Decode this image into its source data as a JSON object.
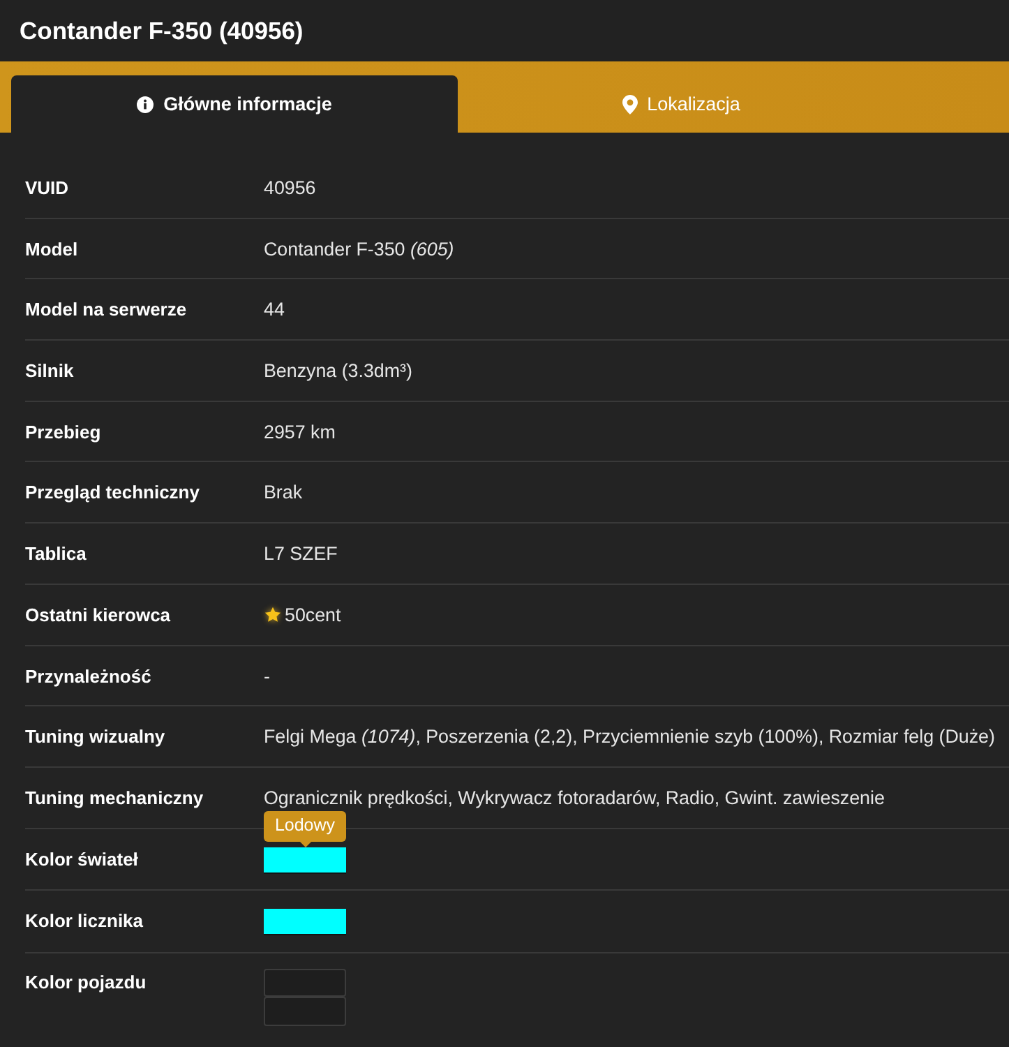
{
  "title": "Contander F-350 (40956)",
  "tabs": [
    {
      "label": "Główne informacje",
      "selected": true
    },
    {
      "label": "Lokalizacja",
      "selected": false
    }
  ],
  "rows": [
    {
      "kind": "text",
      "label": "VUID",
      "value": "40956"
    },
    {
      "kind": "text",
      "label": "Model",
      "value": "Contander F-350 *(605)*"
    },
    {
      "kind": "text",
      "label": "Model na serwerze",
      "value": "44"
    },
    {
      "kind": "text",
      "label": "Silnik",
      "value": "Benzyna (3.3dm³)"
    },
    {
      "kind": "text",
      "label": "Przebieg",
      "value": "2957 km"
    },
    {
      "kind": "text",
      "label": "Przegląd techniczny",
      "value": "Brak"
    },
    {
      "kind": "text",
      "label": "Tablica",
      "value": "L7 SZEF"
    },
    {
      "kind": "driver",
      "label": "Ostatni kierowca",
      "value": "50cent"
    },
    {
      "kind": "text",
      "label": "Przynależność",
      "value": "-"
    },
    {
      "kind": "text",
      "label": "Tuning wizualny",
      "value": "Felgi Mega *(1074)*, Poszerzenia (2,2), Przyciemnienie szyb (100%), Rozmiar felg (Duże)"
    },
    {
      "kind": "text",
      "label": "Tuning mechaniczny",
      "value": "Ogranicznik prędkości, Wykrywacz fotoradarów, Radio, Gwint. zawieszenie"
    },
    {
      "kind": "swatch",
      "label": "Kolor świateł",
      "swatches": [
        {
          "color": "#00ffff",
          "tooltip": "Lodowy"
        }
      ]
    },
    {
      "kind": "swatch",
      "label": "Kolor licznika",
      "swatches": [
        {
          "color": "#00ffff"
        }
      ]
    },
    {
      "kind": "swatch",
      "label": "Kolor pojazdu",
      "swatches": [
        {
          "color": "#1e1e1e"
        },
        {
          "color": "#1e1e1e"
        }
      ]
    }
  ]
}
